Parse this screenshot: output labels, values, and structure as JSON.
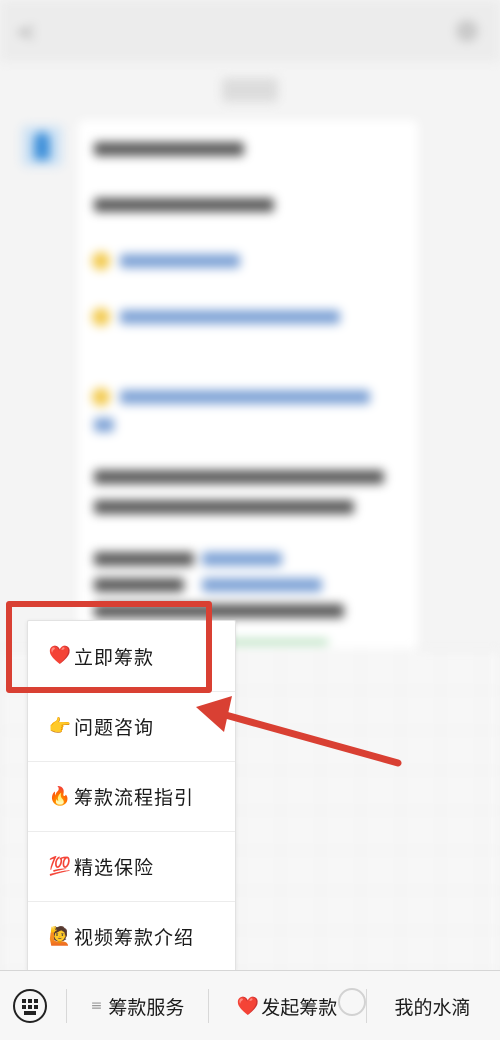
{
  "chat": {
    "title": "",
    "time": ""
  },
  "menu": {
    "items": [
      {
        "emoji": "❤️",
        "label": "立即筹款"
      },
      {
        "emoji": "👉",
        "label": "问题咨询"
      },
      {
        "emoji": "🔥",
        "label": "筹款流程指引"
      },
      {
        "emoji": "💯",
        "label": "精选保险"
      },
      {
        "emoji": "🙋",
        "label": "视频筹款介绍"
      }
    ]
  },
  "bottom_bar": {
    "services_prefix": "≡",
    "services_label": "筹款服务",
    "start_heart": "❤️",
    "start_label": "发起筹款",
    "my_label": "我的水滴"
  },
  "colors": {
    "highlight": "#d94033",
    "arrow": "#d94033"
  }
}
